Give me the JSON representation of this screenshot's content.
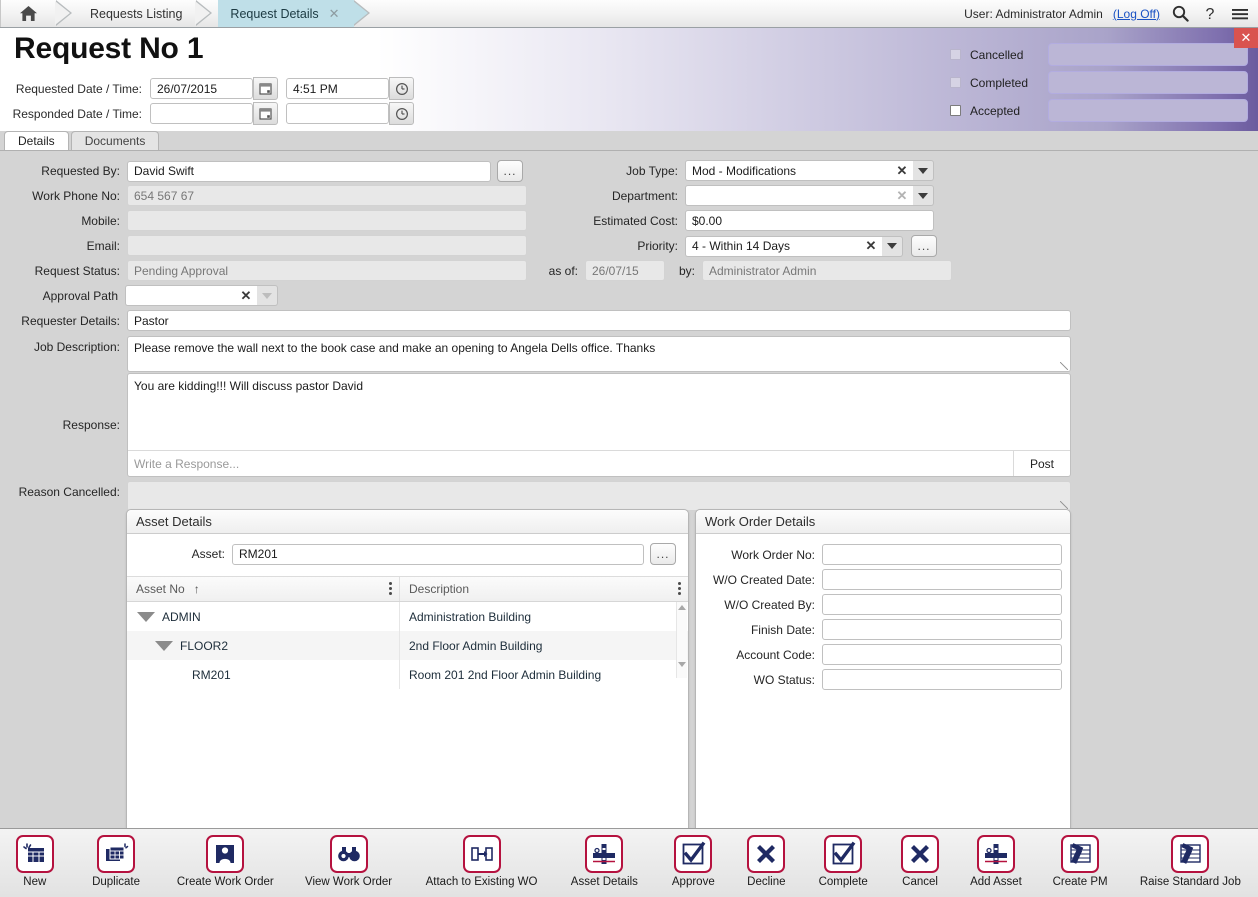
{
  "topbar": {
    "home_icon": "home-icon",
    "tabs": [
      {
        "label": "Requests Listing",
        "active": false,
        "closable": false
      },
      {
        "label": "Request Details",
        "active": true,
        "closable": true
      }
    ],
    "user_text": "User: Administrator Admin",
    "logoff_label": "(Log Off)",
    "search_icon": "search-icon",
    "help_icon": "help-icon",
    "menu_icon": "hamburger-menu-icon"
  },
  "header": {
    "title": "Request No 1",
    "requested_date_label": "Requested Date / Time:",
    "requested_date_value": "26/07/2015",
    "requested_time_value": "4:51 PM",
    "responded_date_label": "Responded Date / Time:",
    "responded_date_value": "",
    "responded_time_value": "",
    "close_label": "✕",
    "status_checks": [
      {
        "label": "Cancelled",
        "checked": false,
        "style": "shaded",
        "value": ""
      },
      {
        "label": "Completed",
        "checked": false,
        "style": "shaded",
        "value": ""
      },
      {
        "label": "Accepted",
        "checked": false,
        "style": "white",
        "value": ""
      }
    ],
    "accent_purple": "#6b5b9e",
    "close_red": "#d9534f"
  },
  "subtabs": [
    {
      "label": "Details",
      "active": true
    },
    {
      "label": "Documents",
      "active": false
    }
  ],
  "form": {
    "left": {
      "requested_by_label": "Requested By:",
      "requested_by_value": "David Swift",
      "work_phone_label": "Work Phone No:",
      "work_phone_value": "654 567 67",
      "mobile_label": "Mobile:",
      "mobile_value": "",
      "email_label": "Email:",
      "email_value": "",
      "request_status_label": "Request Status:",
      "request_status_value": "Pending Approval",
      "approval_path_label": "Approval Path",
      "approval_path_value": "",
      "requester_details_label": "Requester Details:",
      "requester_details_value": "Pastor",
      "job_description_label": "Job Description:",
      "job_description_value": "Please remove the wall next to the book case and make an opening to Angela Dells office. Thanks",
      "response_label": "Response:",
      "response_value": "You are kidding!!!  Will discuss pastor David",
      "response_placeholder": "Write a Response...",
      "post_label": "Post",
      "reason_cancelled_label": "Reason Cancelled:",
      "reason_cancelled_value": "",
      "browse_label": "..."
    },
    "right": {
      "job_type_label": "Job Type:",
      "job_type_value": "Mod - Modifications",
      "department_label": "Department:",
      "department_value": "",
      "estimated_cost_label": "Estimated Cost:",
      "estimated_cost_value": "$0.00",
      "priority_label": "Priority:",
      "priority_value": "4 - Within 14 Days",
      "as_of_label": "as of:",
      "as_of_value": "26/07/15",
      "by_label": "by:",
      "by_value": "Administrator Admin",
      "browse_label": "..."
    }
  },
  "asset_panel": {
    "title": "Asset Details",
    "asset_label": "Asset:",
    "asset_value": "RM201",
    "browse_label": "...",
    "columns": [
      {
        "label": "Asset No",
        "sort": "↑"
      },
      {
        "label": "Description",
        "sort": ""
      }
    ],
    "rows": [
      {
        "asset_no": "ADMIN",
        "description": "Administration Building",
        "indent": 0,
        "expandable": true
      },
      {
        "asset_no": "FLOOR2",
        "description": "2nd Floor Admin Building",
        "indent": 1,
        "expandable": true
      },
      {
        "asset_no": "RM201",
        "description": "Room 201 2nd Floor Admin Building",
        "indent": 2,
        "expandable": false
      }
    ]
  },
  "wo_panel": {
    "title": "Work Order Details",
    "fields": [
      {
        "label": "Work Order No:",
        "value": ""
      },
      {
        "label": "W/O Created Date:",
        "value": ""
      },
      {
        "label": "W/O Created By:",
        "value": ""
      },
      {
        "label": "Finish Date:",
        "value": ""
      },
      {
        "label": "Account Code:",
        "value": ""
      },
      {
        "label": "WO Status:",
        "value": ""
      }
    ]
  },
  "toolbar": {
    "border_color": "#b5123f",
    "glyph_color": "#1f2a63",
    "buttons": [
      {
        "label": "New",
        "icon": "new-record-icon"
      },
      {
        "label": "Duplicate",
        "icon": "duplicate-icon"
      },
      {
        "label": "Create Work Order",
        "icon": "person-work-order-icon"
      },
      {
        "label": "View Work Order",
        "icon": "binoculars-icon"
      },
      {
        "label": "Attach to Existing WO",
        "icon": "attach-arrow-icon"
      },
      {
        "label": "Asset Details",
        "icon": "asset-icon"
      },
      {
        "label": "Approve",
        "icon": "checkmark-icon"
      },
      {
        "label": "Decline",
        "icon": "cross-icon"
      },
      {
        "label": "Complete",
        "icon": "checkmark-icon"
      },
      {
        "label": "Cancel",
        "icon": "cross-icon"
      },
      {
        "label": "Add Asset",
        "icon": "asset-icon"
      },
      {
        "label": "Create PM",
        "icon": "hammer-schedule-icon"
      },
      {
        "label": "Raise Standard Job",
        "icon": "hammer-schedule-icon"
      }
    ]
  }
}
